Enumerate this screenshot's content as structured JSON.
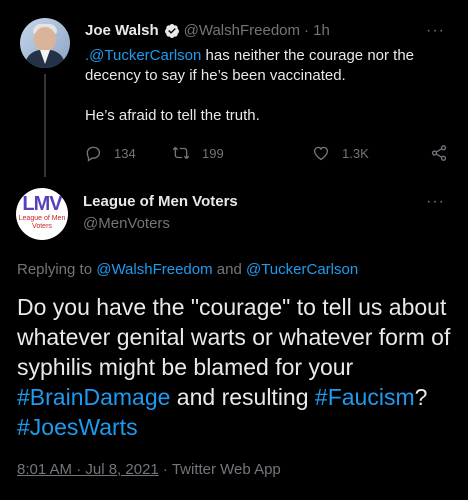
{
  "tweet1": {
    "name": "Joe Walsh",
    "handle": "@WalshFreedom",
    "time": "· 1h",
    "mention": ".@TuckerCarlson",
    "text_after_mention": " has neither the courage nor the decency to say if he’s been vaccinated.",
    "text_line2": "He’s afraid to tell the truth.",
    "replies": "134",
    "retweets": "199",
    "likes": "1.3K",
    "more": "···"
  },
  "tweet2": {
    "name": "League of Men Voters",
    "handle": "@MenVoters",
    "avatar_logo": "LMV",
    "avatar_sub": "League of Men Voters",
    "more": "···",
    "replying_prefix": "Replying to ",
    "replying_user1": "@WalshFreedom",
    "replying_and": " and ",
    "replying_user2": "@TuckerCarlson",
    "body_part1": "Do you have the \"courage\" to tell us about whatever genital warts or whatever form of syphilis might be blamed for your ",
    "hashtag1": "#BrainDamage",
    "body_part2": " and resulting ",
    "hashtag2": "#Faucism",
    "body_part3": "? ",
    "hashtag3": "#JoesWarts",
    "timestamp": "8:01 AM · Jul 8, 2021",
    "source": " · Twitter Web App"
  },
  "colors": {
    "background": "#000000",
    "text": "#e7e9ea",
    "muted": "#71767b",
    "accent": "#1d9bf0"
  },
  "icons": [
    "verified-icon",
    "reply-icon",
    "retweet-icon",
    "like-icon",
    "share-icon",
    "more-icon"
  ]
}
